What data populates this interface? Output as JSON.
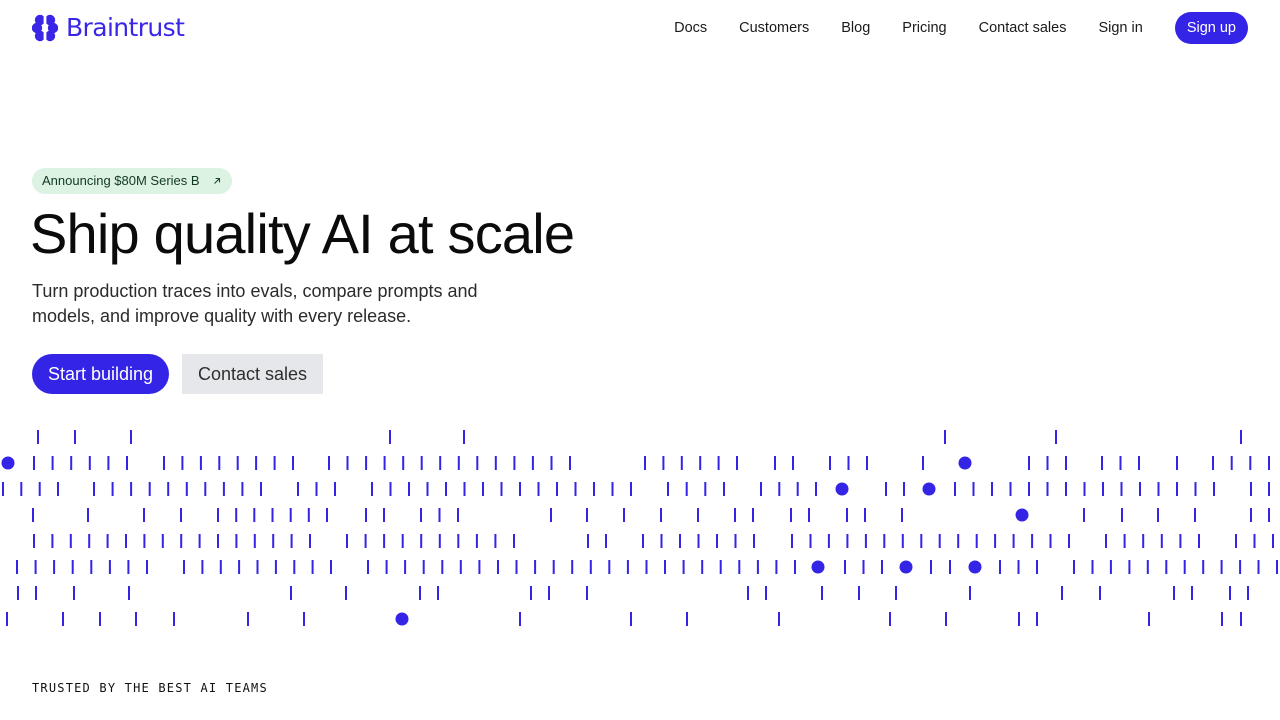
{
  "brand": {
    "name": "Braintrust",
    "color": "#3a26e6",
    "icon": "braintrust-logo-icon"
  },
  "nav": {
    "links": [
      {
        "label": "Docs"
      },
      {
        "label": "Customers"
      },
      {
        "label": "Blog"
      },
      {
        "label": "Pricing"
      },
      {
        "label": "Contact sales"
      }
    ],
    "sign_in": "Sign in",
    "sign_up": "Sign up"
  },
  "hero": {
    "announcement": {
      "label": "Announcing $80M Series B",
      "icon": "arrow-up-right-icon"
    },
    "headline": "Ship quality AI at scale",
    "subtext": "Turn production traces into evals, compare prompts and models, and improve quality with every release.",
    "primary_cta": "Start building",
    "secondary_cta": "Contact sales"
  },
  "visualization": {
    "description_icon": "trace-tick-pattern",
    "mark_color": "#3424e6"
  },
  "trusted": {
    "label": "TRUSTED BY THE BEST AI TEAMS"
  },
  "colors": {
    "accent": "#3424e6",
    "badge_bg": "#dcf2e3",
    "secondary_button_bg": "#e6e7ea"
  }
}
